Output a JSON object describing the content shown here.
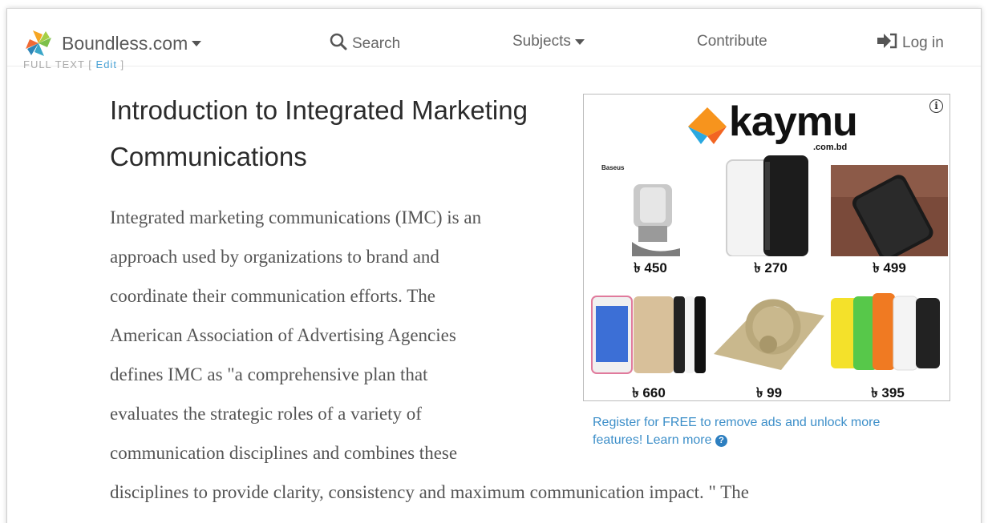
{
  "nav": {
    "brand": "Boundless.com",
    "search": "Search",
    "subjects": "Subjects",
    "contribute": "Contribute",
    "login": "Log in"
  },
  "subnav": {
    "full_text": "FULL TEXT",
    "edit": "Edit"
  },
  "article": {
    "title_line1": "Introduction to Integrated Marketing",
    "title_line2": "Communications",
    "lines": [
      "Integrated marketing communications (IMC) is an",
      "approach used by organizations to brand and",
      "coordinate their communication efforts. The",
      "American Association of Advertising Agencies",
      "defines IMC as \"a comprehensive plan that",
      "evaluates the strategic roles of a variety of",
      "communication disciplines and combines these",
      "disciplines to provide clarity, consistency and maximum communication impact. \" The"
    ]
  },
  "ad": {
    "brand": "kaymu",
    "brand_domain": ".com.bd",
    "info_symbol": "i",
    "baseus_label": "Baseus",
    "products": [
      {
        "price": "৳ 450"
      },
      {
        "price": "৳ 270"
      },
      {
        "price": "৳ 499"
      },
      {
        "price": "৳ 660"
      },
      {
        "price": "৳ 99"
      },
      {
        "price": "৳ 395"
      }
    ],
    "note": "Register for FREE to remove ads and unlock more features! Learn more",
    "help_symbol": "?"
  },
  "colors": {
    "link": "#3d8fc9",
    "kaymu_orange": "#f7941d",
    "kaymu_blue": "#29a8e0"
  }
}
